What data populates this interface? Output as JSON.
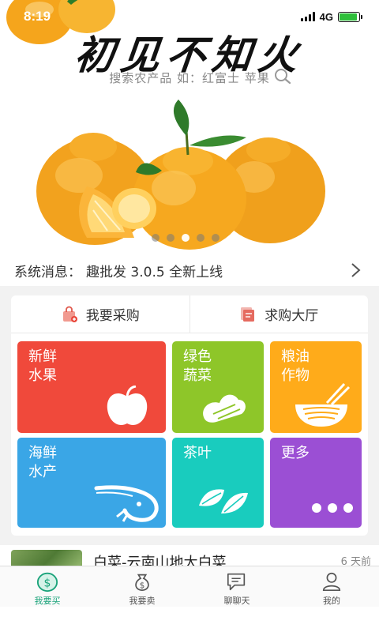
{
  "status": {
    "time": "8:19",
    "network": "4G",
    "battery_level": 0.9
  },
  "header": {
    "title": "初见不知火",
    "search_hint": "搜索农产品 如：红富士 苹果",
    "search_icon": "search-icon"
  },
  "carousel": {
    "slide_count": 5,
    "active_index": 2
  },
  "notice": {
    "label": "系统消息：",
    "text": "趣批发 3.0.5 全新上线"
  },
  "tabs": [
    {
      "label": "我要采购",
      "icon": "shopping-bag-icon"
    },
    {
      "label": "求购大厅",
      "icon": "document-icon"
    }
  ],
  "categories": [
    {
      "line1": "新鲜",
      "line2": "水果",
      "icon": "apple-icon",
      "color": "#f0493b"
    },
    {
      "line1": "绿色",
      "line2": "蔬菜",
      "icon": "vegetable-icon",
      "color": "#8ec629"
    },
    {
      "line1": "粮油",
      "line2": "作物",
      "icon": "noodle-bowl-icon",
      "color": "#ffab1a"
    },
    {
      "line1": "海鲜",
      "line2": "水产",
      "icon": "shrimp-icon",
      "color": "#3aa6e6"
    },
    {
      "line1": "茶叶",
      "line2": "",
      "icon": "tea-leaf-icon",
      "color": "#19ccbe"
    },
    {
      "line1": "更多",
      "line2": "",
      "icon": "more-icon",
      "color": "#9b4fd4"
    }
  ],
  "product": {
    "title": "白菜-云南山地大白菜",
    "time": "6 天前"
  },
  "nav": [
    {
      "label": "我要买",
      "icon": "dollar-icon",
      "active": true
    },
    {
      "label": "我要卖",
      "icon": "money-bag-icon",
      "active": false
    },
    {
      "label": "聊聊天",
      "icon": "chat-icon",
      "active": false
    },
    {
      "label": "我的",
      "icon": "user-icon",
      "active": false
    }
  ],
  "colors": {
    "accent": "#1aa37a",
    "orange": "#f5a51c"
  }
}
